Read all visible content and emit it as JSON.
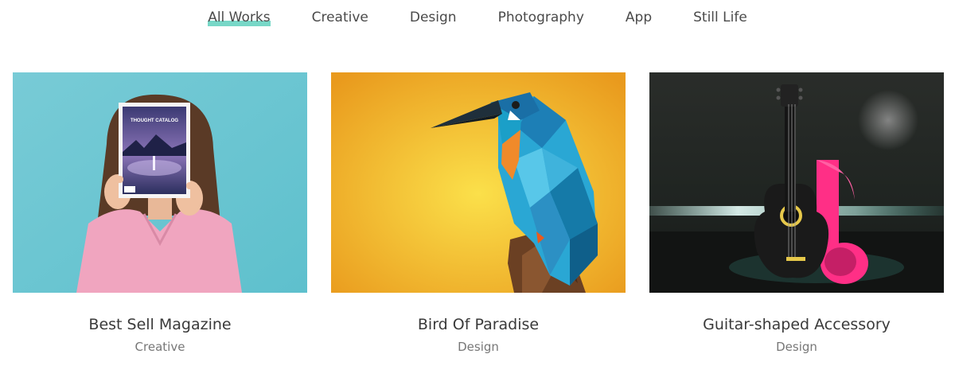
{
  "filters": [
    {
      "label": "All Works",
      "active": true
    },
    {
      "label": "Creative",
      "active": false
    },
    {
      "label": "Design",
      "active": false
    },
    {
      "label": "Photography",
      "active": false
    },
    {
      "label": "App",
      "active": false
    },
    {
      "label": "Still Life",
      "active": false
    }
  ],
  "portfolio": [
    {
      "title": "Best Sell Magazine",
      "category": "Creative",
      "image": "woman-holding-magazine-photo",
      "magazine_text": "THOUGHT CATALOG"
    },
    {
      "title": "Bird Of Paradise",
      "category": "Design",
      "image": "low-poly-kingfisher-illustration"
    },
    {
      "title": "Guitar-shaped Accessory",
      "category": "Design",
      "image": "guitar-music-note-render"
    }
  ],
  "colors": {
    "accent": "#5fd0bd",
    "text": "#3a3a3a",
    "muted": "#777777",
    "teal_bg": "#6ec6d2",
    "yellow_bg": "#f2b428",
    "dark_bg": "#1f2220",
    "pink": "#ff2f86"
  }
}
